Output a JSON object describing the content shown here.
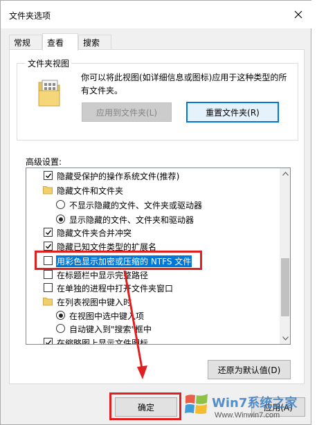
{
  "dialog": {
    "title": "文件夹选项",
    "tabs": [
      "常规",
      "查看",
      "搜索"
    ],
    "active_tab": "查看"
  },
  "folder_views": {
    "group_label": "文件夹视图",
    "description": "你可以将此视图(如详细信息或图标)应用于这种类型的所有文件夹。",
    "apply_button": "应用到文件夹(L)",
    "reset_button": "重置文件夹(R)"
  },
  "advanced": {
    "label": "高级设置:",
    "items": [
      {
        "kind": "checkbox",
        "checked": true,
        "label": "隐藏受保护的操作系统文件(推荐)"
      },
      {
        "kind": "folder",
        "label": "隐藏文件和文件夹"
      },
      {
        "kind": "radio",
        "checked": false,
        "label": "不显示隐藏的文件、文件夹或驱动器"
      },
      {
        "kind": "radio",
        "checked": true,
        "label": "显示隐藏的文件、文件夹和驱动器"
      },
      {
        "kind": "checkbox",
        "checked": true,
        "label": "隐藏文件夹合并冲突"
      },
      {
        "kind": "checkbox",
        "checked": true,
        "label": "隐藏已知文件类型的扩展名"
      },
      {
        "kind": "checkbox",
        "checked": false,
        "label": "用彩色显示加密或压缩的 NTFS 文件",
        "selected": true
      },
      {
        "kind": "checkbox",
        "checked": false,
        "label": "在标题栏中显示完整路径"
      },
      {
        "kind": "checkbox",
        "checked": false,
        "label": "在单独的进程中打开文件夹窗口"
      },
      {
        "kind": "folder",
        "label": "在列表视图中键入时"
      },
      {
        "kind": "radio",
        "checked": true,
        "label": "在视图中选中键入项"
      },
      {
        "kind": "radio",
        "checked": false,
        "label": "自动键入到\"搜索\"框中"
      },
      {
        "kind": "checkbox",
        "checked": true,
        "label": "在缩略图上显示文件图标"
      }
    ],
    "restore_button": "还原为默认值(D)"
  },
  "footer": {
    "ok_button": "确定",
    "apply_button": "应用(A)"
  },
  "watermark": {
    "brand": "Win7系统之家",
    "url": "Www.Winwin7.com"
  },
  "colors": {
    "accent": "#0078d7",
    "highlight": "#e02020"
  }
}
